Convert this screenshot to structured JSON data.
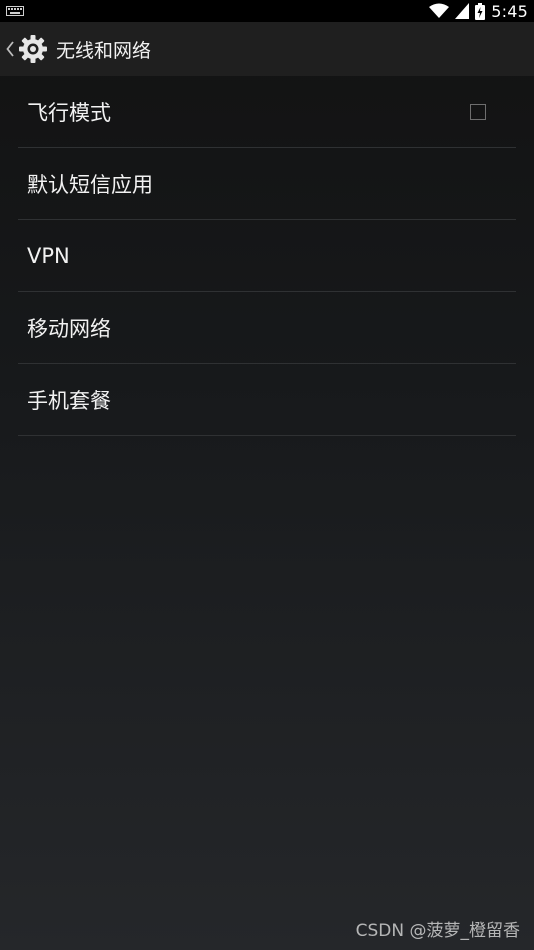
{
  "status_bar": {
    "time": "5:45",
    "left_icon": "keyboard-icon",
    "right_icons": [
      "wifi-icon",
      "signal-icon",
      "battery-icon"
    ]
  },
  "header": {
    "title": "无线和网络",
    "back_icon": "chevron-left-icon",
    "app_icon": "gear-icon"
  },
  "list": {
    "items": [
      {
        "label": "飞行模式",
        "checkbox": false
      },
      {
        "label": "默认短信应用"
      },
      {
        "label": "VPN"
      },
      {
        "label": "移动网络"
      },
      {
        "label": "手机套餐"
      }
    ]
  },
  "watermark": "CSDN @菠萝_橙留香"
}
